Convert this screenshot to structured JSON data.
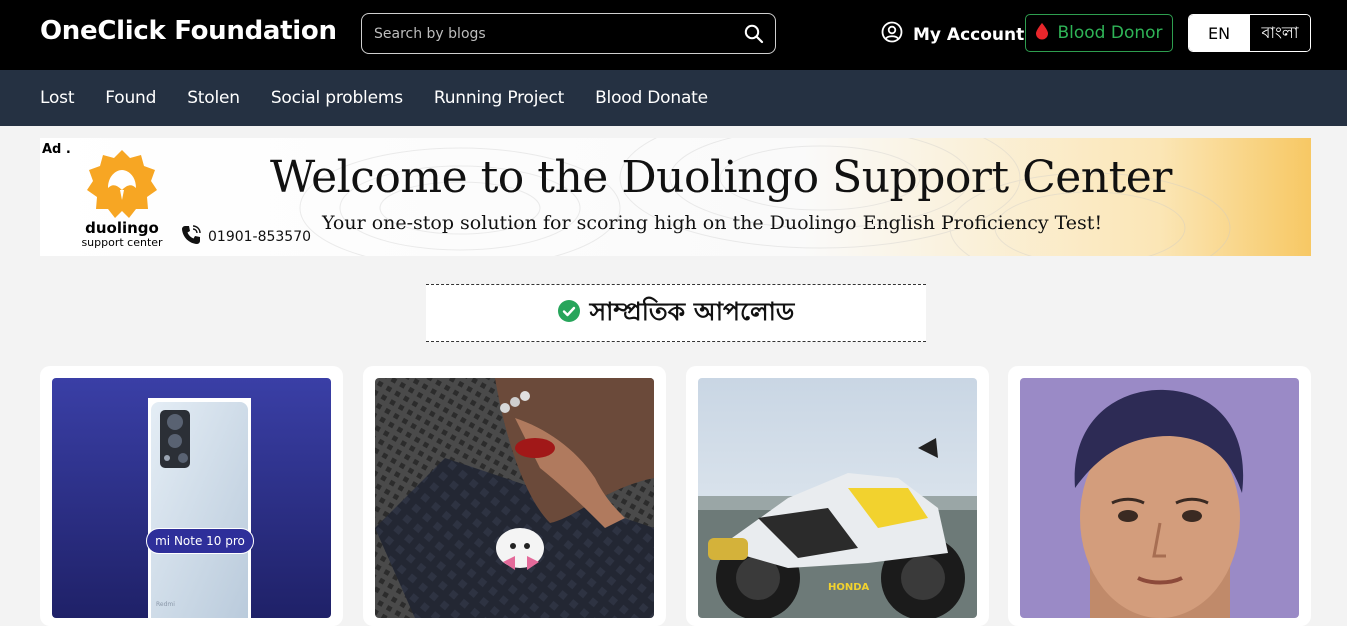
{
  "header": {
    "brand": "OneClick Foundation",
    "search_placeholder": "Search by blogs",
    "account_label": "My Account",
    "blood_donor_label": "Blood Donor",
    "lang_en": "EN",
    "lang_bn": "বাংলা"
  },
  "nav": {
    "items": [
      "Lost",
      "Found",
      "Stolen",
      "Social problems",
      "Running Project",
      "Blood Donate"
    ]
  },
  "ad": {
    "tag": "Ad .",
    "logo_line1": "duolingo",
    "logo_line2": "support center",
    "phone": "01901-853570",
    "headline": "Welcome to the Duolingo Support Center",
    "subline": "Your one-stop solution for scoring high on the Duolingo English Proficiency  Test!"
  },
  "section": {
    "title": "সাম্প্রতিক আপলোড"
  },
  "cards": [
    {
      "caption": "mi Note 10 pro",
      "image": "phone"
    },
    {
      "image": "wallet"
    },
    {
      "image": "motorcycle"
    },
    {
      "image": "child-portrait"
    }
  ],
  "colors": {
    "topbar_bg": "#000000",
    "nav_bg": "#253142",
    "donor_green": "#2fb457",
    "check_green": "#27a55b",
    "page_bg": "#f3f3f3"
  }
}
